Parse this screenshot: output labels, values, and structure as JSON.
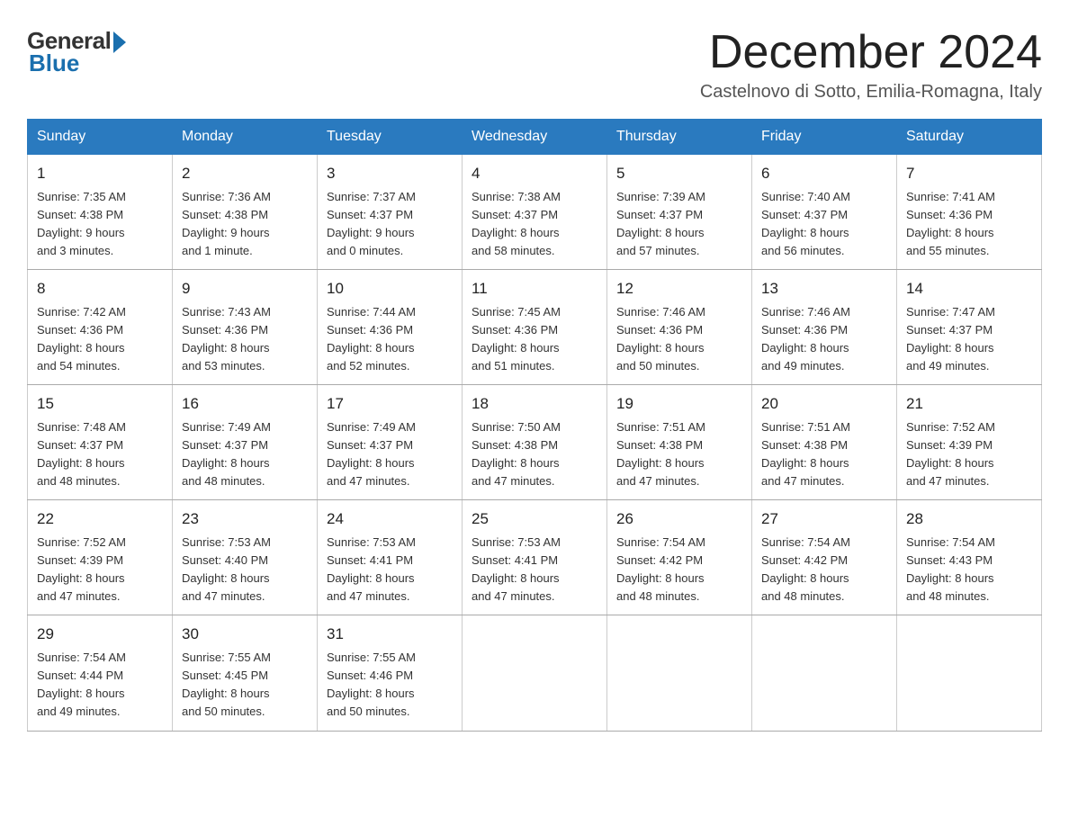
{
  "logo": {
    "general": "General",
    "blue": "Blue"
  },
  "header": {
    "month_year": "December 2024",
    "location": "Castelnovo di Sotto, Emilia-Romagna, Italy"
  },
  "days_of_week": [
    "Sunday",
    "Monday",
    "Tuesday",
    "Wednesday",
    "Thursday",
    "Friday",
    "Saturday"
  ],
  "weeks": [
    [
      {
        "day": "1",
        "info": "Sunrise: 7:35 AM\nSunset: 4:38 PM\nDaylight: 9 hours\nand 3 minutes."
      },
      {
        "day": "2",
        "info": "Sunrise: 7:36 AM\nSunset: 4:38 PM\nDaylight: 9 hours\nand 1 minute."
      },
      {
        "day": "3",
        "info": "Sunrise: 7:37 AM\nSunset: 4:37 PM\nDaylight: 9 hours\nand 0 minutes."
      },
      {
        "day": "4",
        "info": "Sunrise: 7:38 AM\nSunset: 4:37 PM\nDaylight: 8 hours\nand 58 minutes."
      },
      {
        "day": "5",
        "info": "Sunrise: 7:39 AM\nSunset: 4:37 PM\nDaylight: 8 hours\nand 57 minutes."
      },
      {
        "day": "6",
        "info": "Sunrise: 7:40 AM\nSunset: 4:37 PM\nDaylight: 8 hours\nand 56 minutes."
      },
      {
        "day": "7",
        "info": "Sunrise: 7:41 AM\nSunset: 4:36 PM\nDaylight: 8 hours\nand 55 minutes."
      }
    ],
    [
      {
        "day": "8",
        "info": "Sunrise: 7:42 AM\nSunset: 4:36 PM\nDaylight: 8 hours\nand 54 minutes."
      },
      {
        "day": "9",
        "info": "Sunrise: 7:43 AM\nSunset: 4:36 PM\nDaylight: 8 hours\nand 53 minutes."
      },
      {
        "day": "10",
        "info": "Sunrise: 7:44 AM\nSunset: 4:36 PM\nDaylight: 8 hours\nand 52 minutes."
      },
      {
        "day": "11",
        "info": "Sunrise: 7:45 AM\nSunset: 4:36 PM\nDaylight: 8 hours\nand 51 minutes."
      },
      {
        "day": "12",
        "info": "Sunrise: 7:46 AM\nSunset: 4:36 PM\nDaylight: 8 hours\nand 50 minutes."
      },
      {
        "day": "13",
        "info": "Sunrise: 7:46 AM\nSunset: 4:36 PM\nDaylight: 8 hours\nand 49 minutes."
      },
      {
        "day": "14",
        "info": "Sunrise: 7:47 AM\nSunset: 4:37 PM\nDaylight: 8 hours\nand 49 minutes."
      }
    ],
    [
      {
        "day": "15",
        "info": "Sunrise: 7:48 AM\nSunset: 4:37 PM\nDaylight: 8 hours\nand 48 minutes."
      },
      {
        "day": "16",
        "info": "Sunrise: 7:49 AM\nSunset: 4:37 PM\nDaylight: 8 hours\nand 48 minutes."
      },
      {
        "day": "17",
        "info": "Sunrise: 7:49 AM\nSunset: 4:37 PM\nDaylight: 8 hours\nand 47 minutes."
      },
      {
        "day": "18",
        "info": "Sunrise: 7:50 AM\nSunset: 4:38 PM\nDaylight: 8 hours\nand 47 minutes."
      },
      {
        "day": "19",
        "info": "Sunrise: 7:51 AM\nSunset: 4:38 PM\nDaylight: 8 hours\nand 47 minutes."
      },
      {
        "day": "20",
        "info": "Sunrise: 7:51 AM\nSunset: 4:38 PM\nDaylight: 8 hours\nand 47 minutes."
      },
      {
        "day": "21",
        "info": "Sunrise: 7:52 AM\nSunset: 4:39 PM\nDaylight: 8 hours\nand 47 minutes."
      }
    ],
    [
      {
        "day": "22",
        "info": "Sunrise: 7:52 AM\nSunset: 4:39 PM\nDaylight: 8 hours\nand 47 minutes."
      },
      {
        "day": "23",
        "info": "Sunrise: 7:53 AM\nSunset: 4:40 PM\nDaylight: 8 hours\nand 47 minutes."
      },
      {
        "day": "24",
        "info": "Sunrise: 7:53 AM\nSunset: 4:41 PM\nDaylight: 8 hours\nand 47 minutes."
      },
      {
        "day": "25",
        "info": "Sunrise: 7:53 AM\nSunset: 4:41 PM\nDaylight: 8 hours\nand 47 minutes."
      },
      {
        "day": "26",
        "info": "Sunrise: 7:54 AM\nSunset: 4:42 PM\nDaylight: 8 hours\nand 48 minutes."
      },
      {
        "day": "27",
        "info": "Sunrise: 7:54 AM\nSunset: 4:42 PM\nDaylight: 8 hours\nand 48 minutes."
      },
      {
        "day": "28",
        "info": "Sunrise: 7:54 AM\nSunset: 4:43 PM\nDaylight: 8 hours\nand 48 minutes."
      }
    ],
    [
      {
        "day": "29",
        "info": "Sunrise: 7:54 AM\nSunset: 4:44 PM\nDaylight: 8 hours\nand 49 minutes."
      },
      {
        "day": "30",
        "info": "Sunrise: 7:55 AM\nSunset: 4:45 PM\nDaylight: 8 hours\nand 50 minutes."
      },
      {
        "day": "31",
        "info": "Sunrise: 7:55 AM\nSunset: 4:46 PM\nDaylight: 8 hours\nand 50 minutes."
      },
      {
        "day": "",
        "info": ""
      },
      {
        "day": "",
        "info": ""
      },
      {
        "day": "",
        "info": ""
      },
      {
        "day": "",
        "info": ""
      }
    ]
  ]
}
